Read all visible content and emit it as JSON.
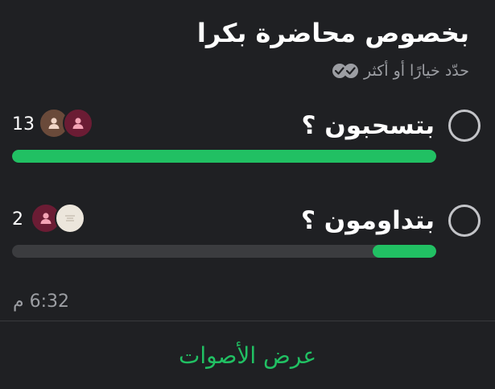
{
  "poll": {
    "title": "بخصوص محاضرة بكرا",
    "subtitle": "حدّد خيارًا أو أكثر",
    "subtitle_icon": "double-check-icon",
    "options": [
      {
        "label": "بتسحبون ؟",
        "votes": "13",
        "fill_fraction": 1.0,
        "avatars": [
          "person-icon",
          "person-icon"
        ]
      },
      {
        "label": "بتداومون ؟",
        "votes": "2",
        "fill_fraction": 0.15,
        "avatars": [
          "person-icon",
          "image-avatar"
        ]
      }
    ],
    "time": "6:32 م",
    "view_votes_label": "عرض الأصوات"
  },
  "colors": {
    "background": "#1f2023",
    "accent": "#21c063",
    "bar_track": "#3b3c3f",
    "muted_text": "#9c9ea3",
    "avatar_brown": "#6a4a3a",
    "avatar_maroon": "#6b1c34",
    "avatar_light": "#ece6dc"
  }
}
